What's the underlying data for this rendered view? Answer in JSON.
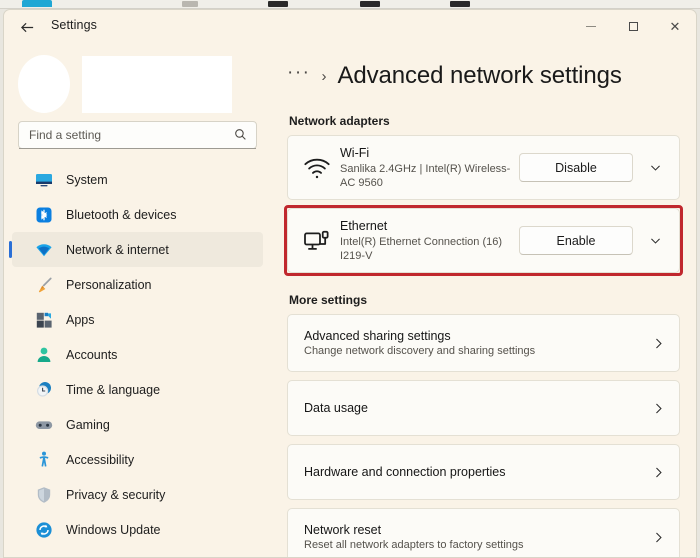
{
  "window": {
    "title": "Settings",
    "back_label": "Back",
    "minimize_label": "Minimize",
    "maximize_label": "Maximize",
    "close_label": "Close"
  },
  "sidebar": {
    "search": {
      "placeholder": "Find a setting",
      "value": ""
    },
    "items": [
      {
        "label": "System",
        "icon": "monitor-icon",
        "selected": false
      },
      {
        "label": "Bluetooth & devices",
        "icon": "bluetooth-icon",
        "selected": false
      },
      {
        "label": "Network & internet",
        "icon": "wifi-icon",
        "selected": true
      },
      {
        "label": "Personalization",
        "icon": "paintbrush-icon",
        "selected": false
      },
      {
        "label": "Apps",
        "icon": "apps-icon",
        "selected": false
      },
      {
        "label": "Accounts",
        "icon": "person-icon",
        "selected": false
      },
      {
        "label": "Time & language",
        "icon": "clock-icon",
        "selected": false
      },
      {
        "label": "Gaming",
        "icon": "gamepad-icon",
        "selected": false
      },
      {
        "label": "Accessibility",
        "icon": "accessibility-icon",
        "selected": false
      },
      {
        "label": "Privacy & security",
        "icon": "shield-icon",
        "selected": false
      },
      {
        "label": "Windows Update",
        "icon": "update-icon",
        "selected": false
      }
    ]
  },
  "main": {
    "breadcrumb_overflow": "···",
    "breadcrumb_separator": "›",
    "page_title": "Advanced network settings",
    "adapters_heading": "Network adapters",
    "more_heading": "More settings",
    "adapters": [
      {
        "name": "Wi-Fi",
        "description": "Sanlika 2.4GHz | Intel(R) Wireless-AC 9560",
        "button": "Disable",
        "icon": "wifi-signal-icon",
        "highlighted": false
      },
      {
        "name": "Ethernet",
        "description": "Intel(R) Ethernet Connection (16) I219-V",
        "button": "Enable",
        "icon": "ethernet-icon",
        "highlighted": true
      }
    ],
    "more_settings": [
      {
        "title": "Advanced sharing settings",
        "subtitle": "Change network discovery and sharing settings"
      },
      {
        "title": "Data usage",
        "subtitle": ""
      },
      {
        "title": "Hardware and connection properties",
        "subtitle": ""
      },
      {
        "title": "Network reset",
        "subtitle": "Reset all network adapters to factory settings"
      }
    ]
  },
  "colors": {
    "page_background": "#faf3e7",
    "card_background": "#fcfbf7",
    "accent": "#2a6fd6",
    "highlight_border": "#c0272d"
  }
}
